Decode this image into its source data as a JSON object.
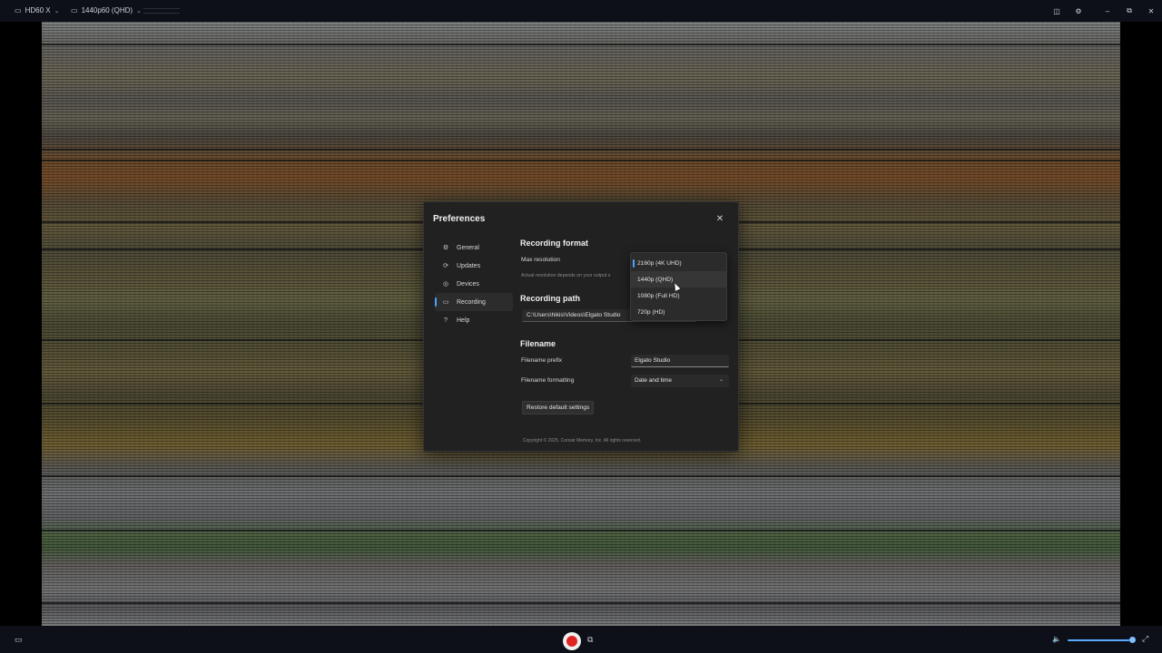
{
  "topbar": {
    "device": "HD60 X",
    "format": "1440p60 (QHD)",
    "icons": [
      "device-icon",
      "camera-icon",
      "chevron-down-icon",
      "sidebar-toggle-icon",
      "settings-icon",
      "minimize-icon",
      "restore-icon",
      "close-icon"
    ]
  },
  "preferences": {
    "title": "Preferences",
    "close_icon": "✕",
    "nav": [
      {
        "label": "General",
        "icon": "⚙"
      },
      {
        "label": "Updates",
        "icon": "⟳"
      },
      {
        "label": "Devices",
        "icon": "◎"
      },
      {
        "label": "Recording",
        "icon": "▭",
        "active": true
      },
      {
        "label": "Help",
        "icon": "?"
      }
    ],
    "recording_format": {
      "title": "Recording format",
      "max_resolution_label": "Max resolution",
      "hint": "Actual resolution depends on your output s"
    },
    "recording_path": {
      "title": "Recording path",
      "value": "C:\\Users\\hikis\\Videos\\Elgato Studio"
    },
    "filename": {
      "title": "Filename",
      "prefix_label": "Filename prefix",
      "prefix_value": "Elgato Studio",
      "formatting_label": "Filename formatting",
      "formatting_value": "Date and time"
    },
    "restore_label": "Restore default settings",
    "copyright": "Copyright © 2025, Corsair Memory, Inc. All rights reserved."
  },
  "resolution_dropdown": {
    "options": [
      "2160p (4K UHD)",
      "1440p (QHD)",
      "1080p (Full HD)",
      "720p (HD)"
    ],
    "selected_index": 0,
    "hover_index": 1
  },
  "bottombar": {
    "volume_level": 0.95
  },
  "colors": {
    "accent": "#4aa3ff",
    "record": "#e02424"
  }
}
